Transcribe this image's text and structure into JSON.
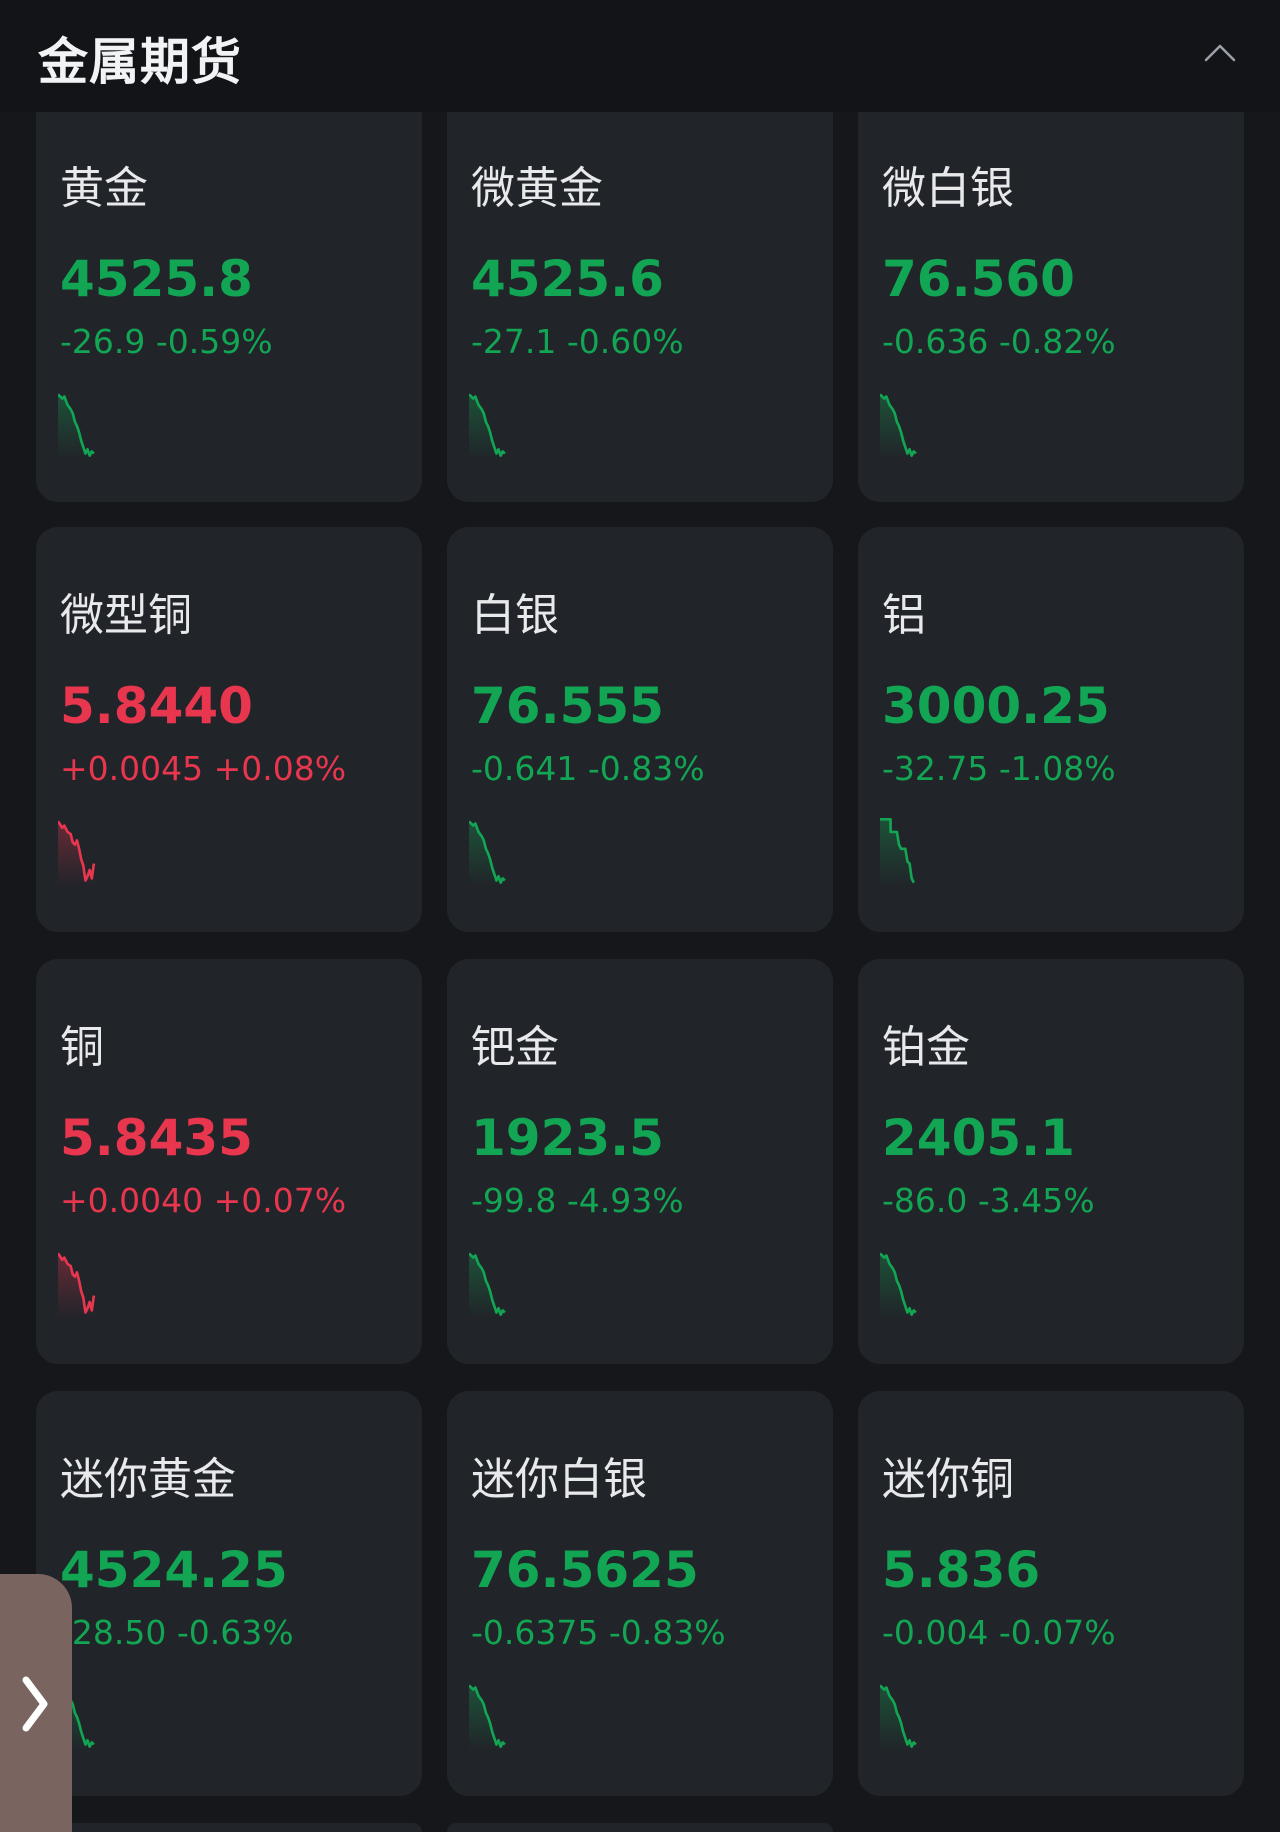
{
  "header": {
    "title": "金属期货",
    "collapse_icon": "chevron-up-icon"
  },
  "colors": {
    "up": "#e8364e",
    "down": "#12a553",
    "card_bg": "#212429",
    "page_bg": "#15171b"
  },
  "cards": [
    {
      "name": "黄金",
      "price": "4525.8",
      "change": "-26.9 -0.59%",
      "direction": "down"
    },
    {
      "name": "微黄金",
      "price": "4525.6",
      "change": "-27.1 -0.60%",
      "direction": "down"
    },
    {
      "name": "微白银",
      "price": "76.560",
      "change": "-0.636 -0.82%",
      "direction": "down"
    },
    {
      "name": "微型铜",
      "price": "5.8440",
      "change": "+0.0045 +0.08%",
      "direction": "up"
    },
    {
      "name": "白银",
      "price": "76.555",
      "change": "-0.641 -0.83%",
      "direction": "down"
    },
    {
      "name": "铝",
      "price": "3000.25",
      "change": "-32.75 -1.08%",
      "direction": "down"
    },
    {
      "name": "铜",
      "price": "5.8435",
      "change": "+0.0040 +0.07%",
      "direction": "up"
    },
    {
      "name": "钯金",
      "price": "1923.5",
      "change": "-99.8 -4.93%",
      "direction": "down"
    },
    {
      "name": "铂金",
      "price": "2405.1",
      "change": "-86.0 -3.45%",
      "direction": "down"
    },
    {
      "name": "迷你黄金",
      "price": "4524.25",
      "change": "-28.50 -0.63%",
      "direction": "down"
    },
    {
      "name": "迷你白银",
      "price": "76.5625",
      "change": "-0.6375 -0.83%",
      "direction": "down"
    },
    {
      "name": "迷你铜",
      "price": "5.836",
      "change": "-0.004 -0.07%",
      "direction": "down"
    }
  ],
  "side_handle": {
    "icon": "chevron-right-icon"
  }
}
